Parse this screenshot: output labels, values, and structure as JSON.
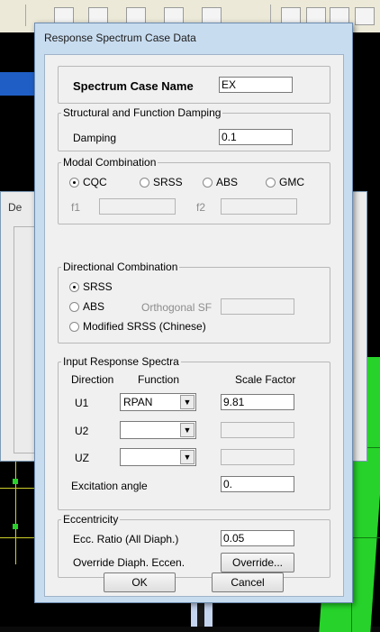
{
  "dialog": {
    "title": "Response Spectrum Case Data",
    "spectrum_case_name_label": "Spectrum Case Name",
    "spectrum_case_name_value": "EX",
    "damping_group": {
      "title": "Structural and Function Damping",
      "damping_label": "Damping",
      "damping_value": "0.1"
    },
    "modal_group": {
      "title": "Modal Combination",
      "options": [
        "CQC",
        "SRSS",
        "ABS",
        "GMC"
      ],
      "selected": "CQC",
      "f1_label": "f1",
      "f1_value": "",
      "f2_label": "f2",
      "f2_value": ""
    },
    "directional_group": {
      "title": "Directional Combination",
      "options": [
        "SRSS",
        "ABS",
        "Modified SRSS (Chinese)"
      ],
      "selected": "SRSS",
      "orthogonal_label": "Orthogonal SF",
      "orthogonal_value": ""
    },
    "input_group": {
      "title": "Input Response Spectra",
      "col_direction": "Direction",
      "col_function": "Function",
      "col_scale": "Scale Factor",
      "rows": [
        {
          "direction": "U1",
          "function": "RPAN",
          "scale": "9.81"
        },
        {
          "direction": "U2",
          "function": "",
          "scale": ""
        },
        {
          "direction": "UZ",
          "function": "",
          "scale": ""
        }
      ],
      "excitation_label": "Excitation  angle",
      "excitation_value": "0."
    },
    "eccentricity_group": {
      "title": "Eccentricity",
      "ecc_label": "Ecc. Ratio (All Diaph.)",
      "ecc_value": "0.05",
      "override_label": "Override Diaph. Eccen.",
      "override_button": "Override..."
    },
    "ok_button": "OK",
    "cancel_button": "Cancel"
  },
  "background_dialog": {
    "title_fragment": "De"
  }
}
